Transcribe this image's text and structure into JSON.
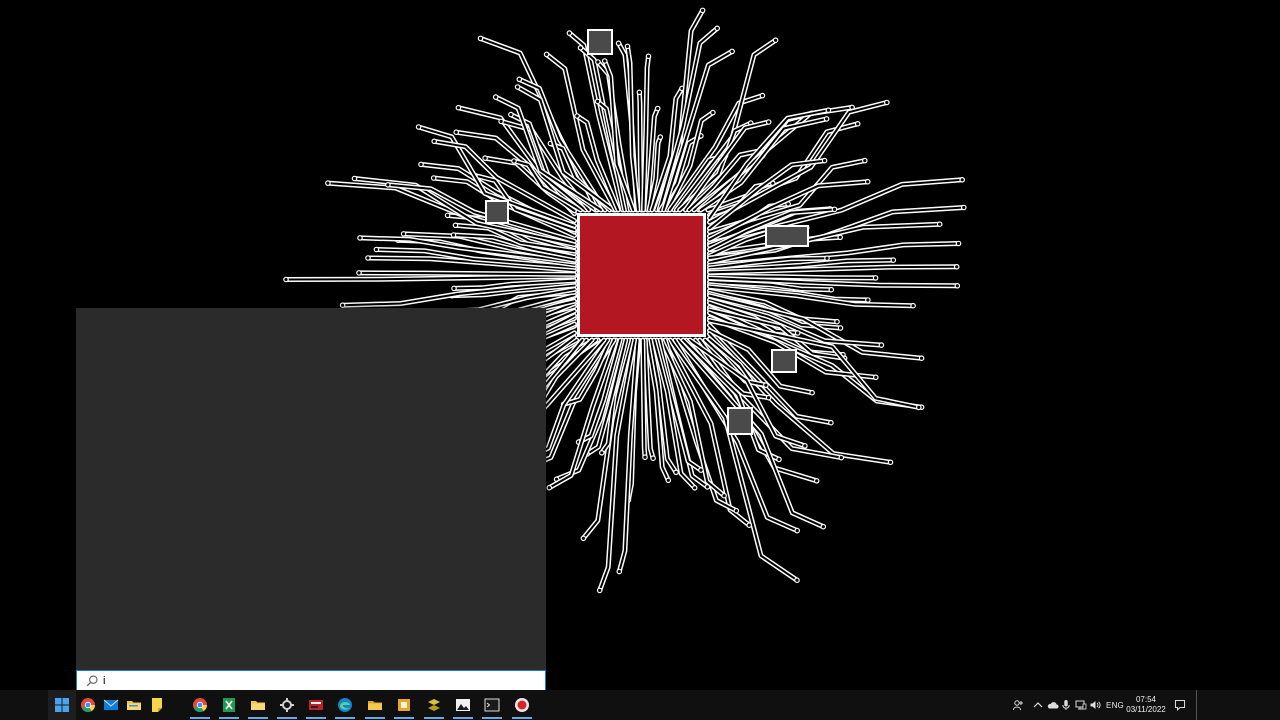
{
  "search": {
    "placeholder": "",
    "value": "i"
  },
  "taskbar": {
    "pinned": [
      {
        "name": "start-button",
        "icon": "windows-logo-icon"
      },
      {
        "name": "chrome-button",
        "icon": "chrome-icon"
      },
      {
        "name": "mail-button",
        "icon": "mail-icon"
      },
      {
        "name": "file-explorer-button",
        "icon": "folder-icon"
      },
      {
        "name": "sticky-notes-button",
        "icon": "sticky-note-icon"
      },
      {
        "name": "chrome-2-button",
        "icon": "chrome-icon"
      },
      {
        "name": "spreadsheet-button",
        "icon": "spreadsheet-icon"
      },
      {
        "name": "folder-button",
        "icon": "folder-icon"
      },
      {
        "name": "tools-button",
        "icon": "tools-icon"
      },
      {
        "name": "media-button",
        "icon": "media-icon"
      },
      {
        "name": "edge-button",
        "icon": "edge-icon"
      },
      {
        "name": "file-explorer-2-button",
        "icon": "folder-icon"
      },
      {
        "name": "office-button",
        "icon": "office-icon"
      },
      {
        "name": "code-button",
        "icon": "code-icon"
      },
      {
        "name": "photos-button",
        "icon": "image-icon"
      },
      {
        "name": "terminal-button",
        "icon": "terminal-icon"
      },
      {
        "name": "recorder-button",
        "icon": "recorder-icon"
      }
    ],
    "tray": {
      "language": "ENG",
      "time": "07:54",
      "date": "03/11/2022"
    }
  },
  "colors": {
    "chip": "#b31722",
    "taskbar": "#101010",
    "flyout": "#2b2b2b",
    "accent": "#1f7ad4"
  }
}
